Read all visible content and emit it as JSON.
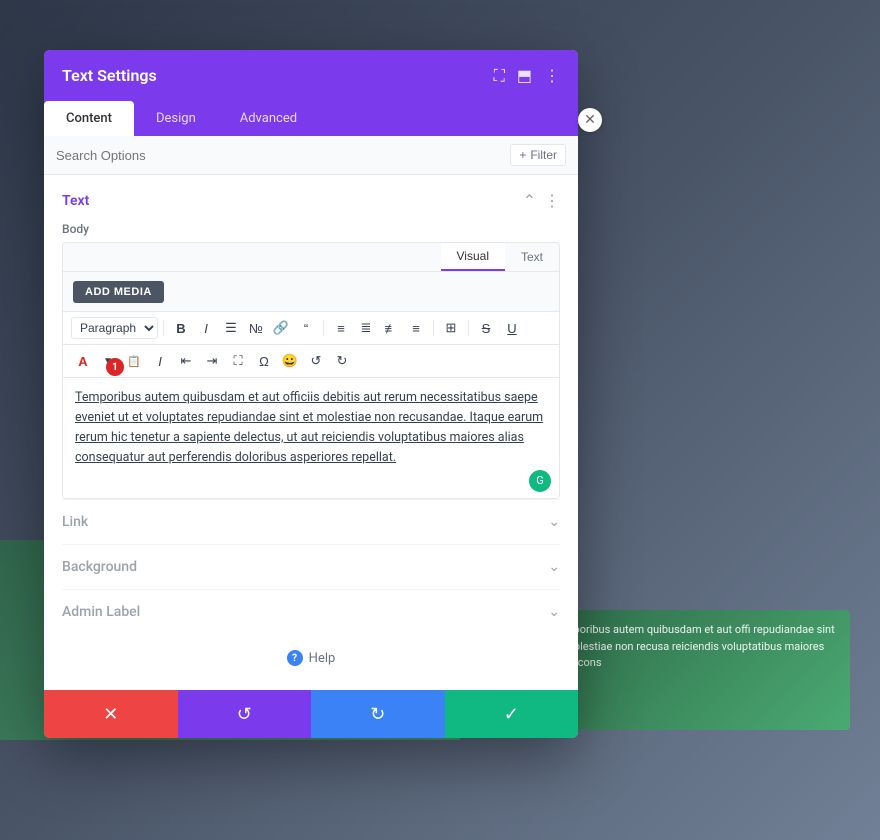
{
  "modal": {
    "title": "Text Settings",
    "header_icons": [
      "resize",
      "columns",
      "more"
    ],
    "tabs": [
      {
        "label": "Content",
        "active": true
      },
      {
        "label": "Design",
        "active": false
      },
      {
        "label": "Advanced",
        "active": false
      }
    ],
    "search": {
      "placeholder": "Search Options",
      "filter_label": "+ Filter"
    },
    "section_text": {
      "title": "Text",
      "body_label": "Body",
      "add_media_btn": "ADD MEDIA",
      "view_visual": "Visual",
      "view_text": "Text",
      "toolbar": {
        "paragraph_select": "Paragraph",
        "table_select": "Table"
      },
      "editor_content": "Temporibus autem quibusdam et aut officiis debitis aut rerum necessitatibus saepe eveniet ut et voluptates repudiandae sint et molestiae non recusandae. Itaque earum rerum hic tenetur a sapiente delectus, ut aut reiciendis voluptatibus maiores alias consequatur aut perferendis doloribus asperiores repellat.",
      "number_badge": "1"
    },
    "sections": [
      {
        "label": "Link"
      },
      {
        "label": "Background"
      },
      {
        "label": "Admin Label"
      }
    ],
    "help_label": "Help",
    "footer": {
      "cancel": "✕",
      "undo": "↺",
      "redo": "↻",
      "save": "✓"
    }
  },
  "preview": {
    "text": "Temporibus autem quibusdam et aut offi repudiandae sint et molestiae non recusa reiciendis voluptatibus maiores alias cons"
  }
}
